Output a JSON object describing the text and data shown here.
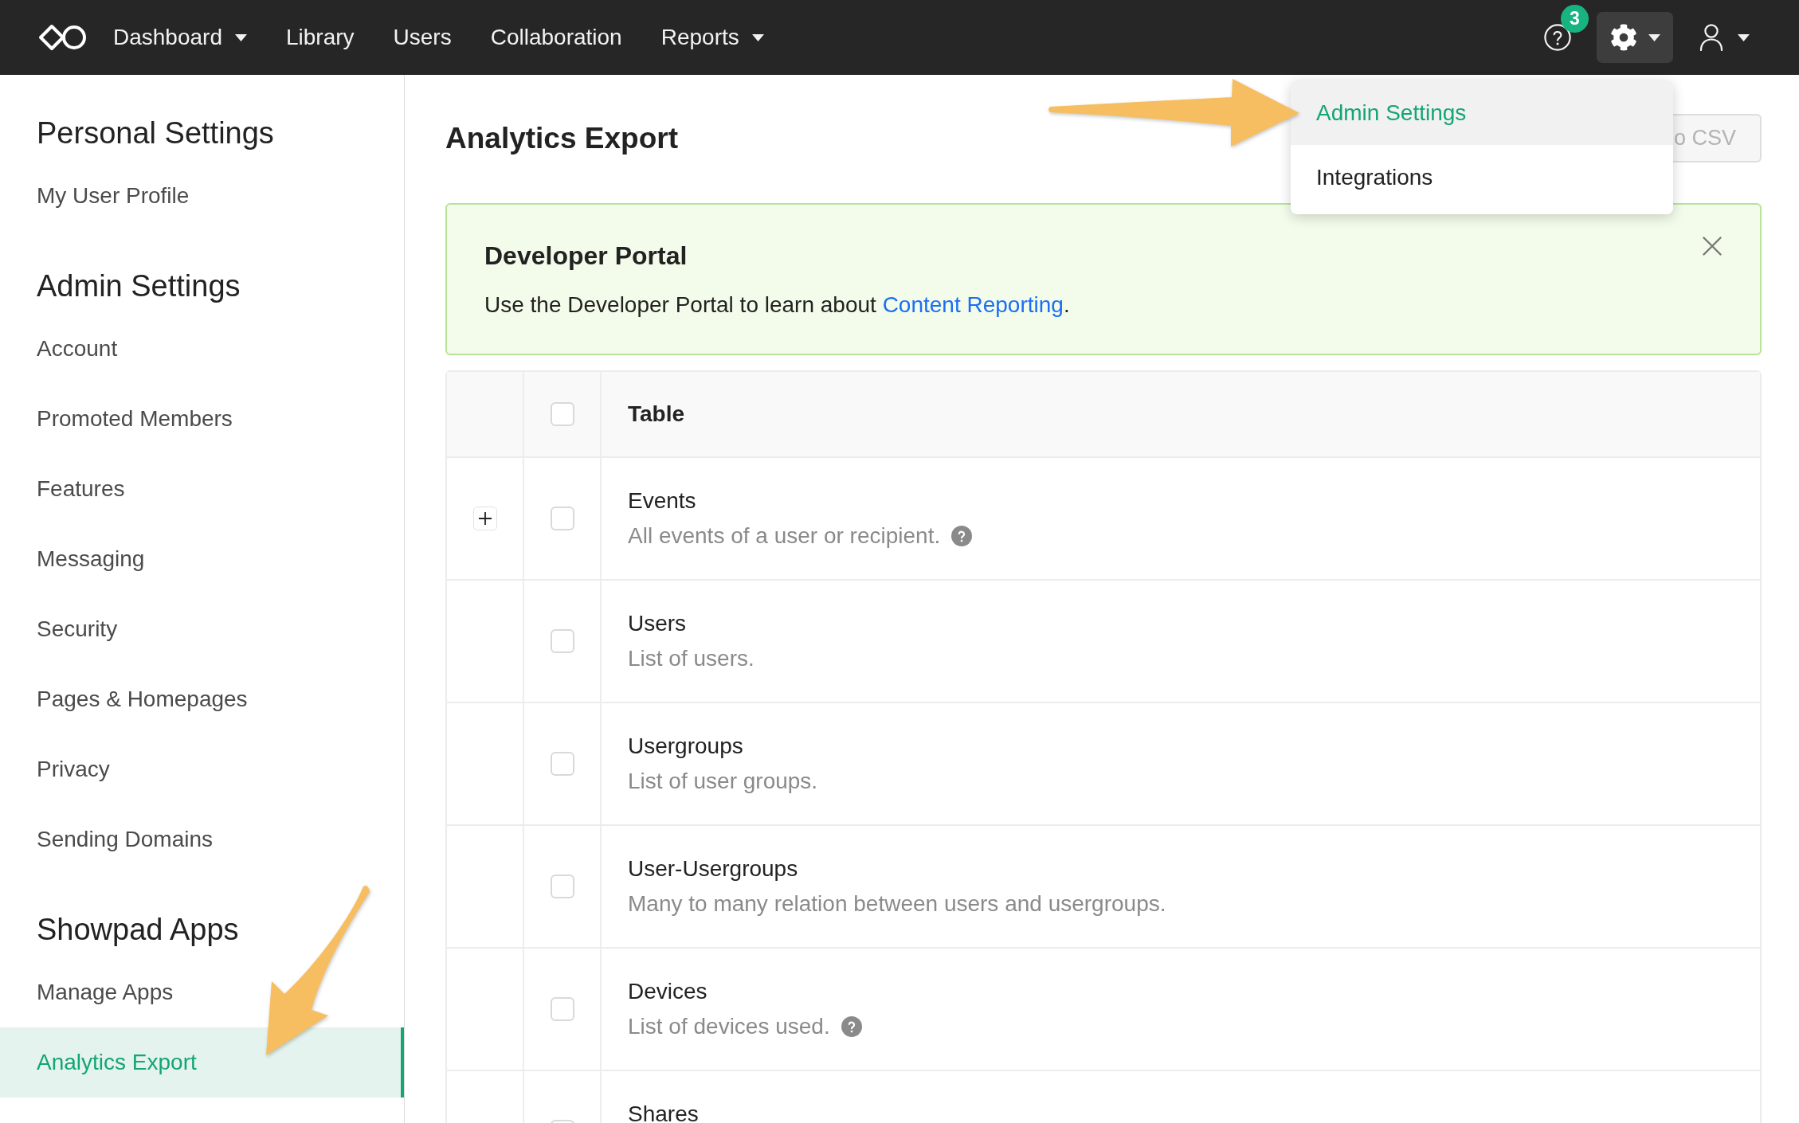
{
  "nav": {
    "items": [
      {
        "label": "Dashboard",
        "dropdown": true
      },
      {
        "label": "Library",
        "dropdown": false
      },
      {
        "label": "Users",
        "dropdown": false
      },
      {
        "label": "Collaboration",
        "dropdown": false
      },
      {
        "label": "Reports",
        "dropdown": true
      }
    ],
    "help_badge": "3",
    "settings_menu": {
      "open": true,
      "items": [
        {
          "label": "Admin Settings",
          "selected": true
        },
        {
          "label": "Integrations",
          "selected": false
        }
      ]
    }
  },
  "sidebar": {
    "sections": [
      {
        "title": "Personal Settings",
        "items": [
          {
            "label": "My User Profile",
            "selected": false
          }
        ]
      },
      {
        "title": "Admin Settings",
        "items": [
          {
            "label": "Account",
            "selected": false
          },
          {
            "label": "Promoted Members",
            "selected": false
          },
          {
            "label": "Features",
            "selected": false
          },
          {
            "label": "Messaging",
            "selected": false
          },
          {
            "label": "Security",
            "selected": false
          },
          {
            "label": "Pages & Homepages",
            "selected": false
          },
          {
            "label": "Privacy",
            "selected": false
          },
          {
            "label": "Sending Domains",
            "selected": false
          }
        ]
      },
      {
        "title": "Showpad Apps",
        "items": [
          {
            "label": "Manage Apps",
            "selected": false
          },
          {
            "label": "Analytics Export",
            "selected": true
          }
        ]
      }
    ]
  },
  "page": {
    "title": "Analytics Export",
    "export_button": {
      "label": "o CSV",
      "disabled": true
    }
  },
  "banner": {
    "title": "Developer Portal",
    "text": "Use the Developer Portal to learn about ",
    "link": "Content Reporting",
    "text_end": ".",
    "dismissible": true
  },
  "table": {
    "header": {
      "label": "Table",
      "checked": false
    },
    "rows": [
      {
        "name": "Events",
        "description": "All events of a user or recipient.",
        "help": true,
        "expandable": true,
        "checked": false
      },
      {
        "name": "Users",
        "description": "List of users.",
        "help": false,
        "expandable": false,
        "checked": false
      },
      {
        "name": "Usergroups",
        "description": "List of user groups.",
        "help": false,
        "expandable": false,
        "checked": false
      },
      {
        "name": "User-Usergroups",
        "description": "Many to many relation between users and usergroups.",
        "help": false,
        "expandable": false,
        "checked": false
      },
      {
        "name": "Devices",
        "description": "List of devices used.",
        "help": true,
        "expandable": false,
        "checked": false
      },
      {
        "name": "Shares",
        "help": false,
        "expandable": false,
        "checked": false
      }
    ]
  }
}
